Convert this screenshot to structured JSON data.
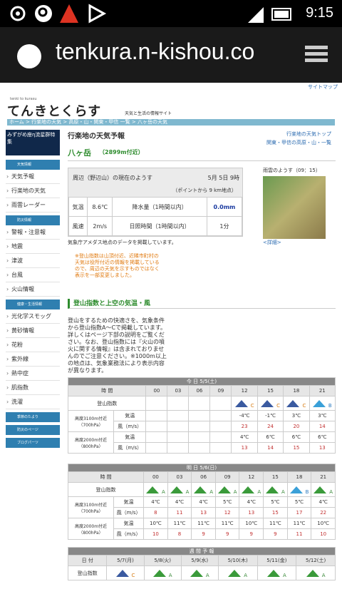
{
  "status": {
    "time": "9:15"
  },
  "browser": {
    "url": "tenkura.n-kishou.co"
  },
  "header": {
    "logo_small": "tenki to kurasu",
    "logo": "てんきとくらす",
    "tagline": "天気と生活の情報サイト",
    "sitemap": "サイトマップ"
  },
  "breadcrumb": "ホーム > 行楽地の天気 > 高原・山・関東・甲信 一覧 > 八ヶ岳の天気",
  "sidebar": {
    "banner": "みずがめ座η流星群特集",
    "sections": [
      {
        "head": "天気情報",
        "items": [
          "天気予報",
          "行楽地の天気",
          "雨雲レーダー"
        ]
      },
      {
        "head": "防災情報",
        "items": [
          "警報・注意報",
          "地震",
          "津波",
          "台風",
          "火山情報"
        ]
      },
      {
        "head": "健康・生活情報",
        "items": [
          "光化学スモッグ",
          "黄砂情報",
          "花粉",
          "紫外線",
          "熱中症",
          "肌指数",
          "洗濯"
        ]
      },
      {
        "head": "季節のたより",
        "items": []
      },
      {
        "head": "防災のページ",
        "items": []
      },
      {
        "head": "ブログパーツ",
        "items": []
      }
    ]
  },
  "main": {
    "title": "行楽地の天気予報",
    "links": [
      "行楽地の天気トップ",
      "関東・甲信の高原・山・一覧"
    ],
    "location": "八ヶ岳",
    "altitude": "（2899m付近）",
    "current": {
      "head": "周辺（野辺山）の現在のようす",
      "date": "5月 5日 9時",
      "point": "（ポイントから 9 km地点）",
      "temp_label": "気温",
      "temp": "8.6℃",
      "rain_label": "降水量（1時間以内）",
      "rain": "0.0mm",
      "wind_label": "風速",
      "wind": "2m/s",
      "sun_label": "日照時間（1時間以内）",
      "sun": "1分",
      "note": "気象庁アメダス地点のデータを掲載しています。"
    },
    "warning": "※登山指数は山頂付近、近隣市町村の天気は役所付近の情報を掲載しているので、周辺の天気を示すものではなく表示を一部変更しました。",
    "radar": {
      "title": "雨雲のようす（09：15）",
      "link": "<詳細>"
    },
    "section": "登山指数と上空の気温・風",
    "desc": "登山をするための快適さを、気象条件から登山指数A〜Cで掲載しています。詳しくはページ下部の説明をご覧ください。なお、登山指数には『火山の噴火に関する情報』は含まれておりませんのでご注意ください。※1000m以上の地点は、気象業務法により表示内容が異なります。",
    "today": {
      "day": "今 日 5/5(土)",
      "times": [
        "00",
        "03",
        "06",
        "09",
        "12",
        "15",
        "18",
        "21"
      ],
      "index": [
        "",
        "",
        "",
        "",
        "C",
        "C",
        "C",
        "B"
      ],
      "t3100": [
        "",
        "",
        "",
        "",
        "-4℃",
        "-1℃",
        "3℃",
        "3℃"
      ],
      "w3100": [
        "",
        "",
        "",
        "",
        "23",
        "24",
        "20",
        "14"
      ],
      "t2000": [
        "",
        "",
        "",
        "",
        "4℃",
        "6℃",
        "6℃",
        "6℃"
      ],
      "w2000": [
        "",
        "",
        "",
        "",
        "13",
        "14",
        "15",
        "13"
      ]
    },
    "tomorrow": {
      "day": "明 日 5/6(日)",
      "times": [
        "00",
        "03",
        "06",
        "09",
        "12",
        "15",
        "18",
        "21"
      ],
      "index": [
        "A",
        "A",
        "A",
        "A",
        "A",
        "A",
        "B",
        "A"
      ],
      "t3100": [
        "4℃",
        "4℃",
        "4℃",
        "5℃",
        "4℃",
        "5℃",
        "5℃",
        "4℃"
      ],
      "w3100": [
        "8",
        "11",
        "13",
        "12",
        "13",
        "15",
        "17",
        "22"
      ],
      "t2000": [
        "10℃",
        "11℃",
        "11℃",
        "11℃",
        "10℃",
        "11℃",
        "11℃",
        "10℃"
      ],
      "w2000": [
        "10",
        "8",
        "9",
        "9",
        "9",
        "9",
        "11",
        "10"
      ]
    },
    "labels": {
      "time": "時 間",
      "index": "登山指数",
      "h3100": "高度3100m付近（700hPa）",
      "h2000": "高度2000m付近（800hPa）",
      "temp": "気温",
      "wind": "風（m/s）"
    },
    "weekly": {
      "head": "週 間 予 報",
      "date_label": "日 付",
      "index_label": "登山指数",
      "days": [
        "5/7(月)",
        "5/8(火)",
        "5/9(水)",
        "5/10(木)",
        "5/11(金)",
        "5/12(土)"
      ],
      "index": [
        "C",
        "A",
        "A",
        "A",
        "A",
        "A"
      ]
    }
  }
}
